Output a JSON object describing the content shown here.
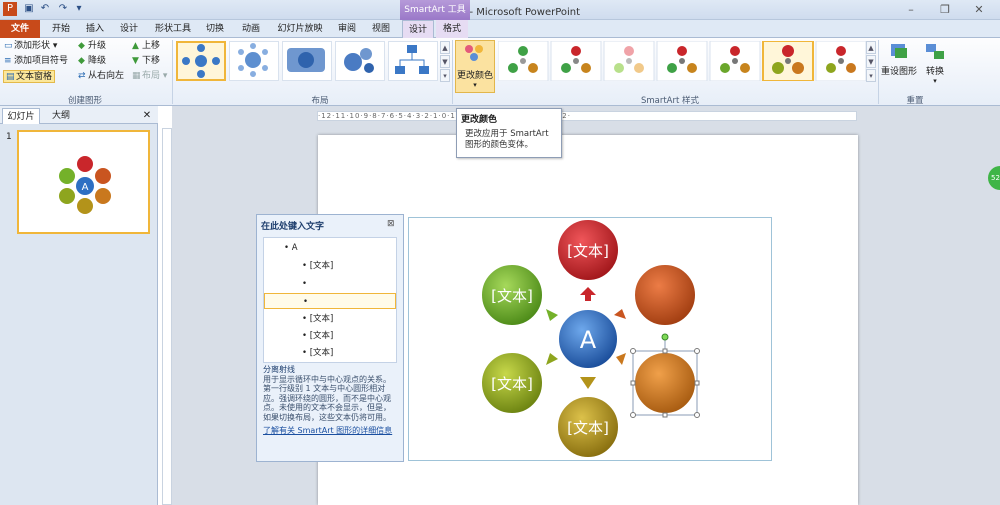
{
  "titlebar": {
    "title": "演示文稿1 - Microsoft PowerPoint",
    "context_group": "SmartArt 工具"
  },
  "tabs": [
    "文件",
    "开始",
    "插入",
    "设计",
    "形状工具",
    "切换",
    "动画",
    "幻灯片放映",
    "审阅",
    "视图",
    "设计",
    "格式"
  ],
  "ribbon": {
    "create_graphic": {
      "label": "创建图形",
      "add_shape": "添加形状",
      "add_bullet": "添加项目符号",
      "text_pane": "文本窗格",
      "promote": "升级",
      "demote": "降级",
      "right_to_left": "从右向左",
      "move_up": "上移",
      "move_down": "下移",
      "layout": "布局"
    },
    "layouts_label": "布局",
    "change_colors": "更改颜色",
    "styles_label": "SmartArt 样式",
    "reset_graphic": "重设图形",
    "convert": "转换",
    "reset_label": "重置"
  },
  "tooltip": {
    "title": "更改颜色",
    "body": "更改应用于 SmartArt 图形的颜色变体。"
  },
  "left_pane": {
    "tab_slides": "幻灯片",
    "tab_outline": "大纲",
    "slide_number": "1",
    "thumb_center": "A"
  },
  "ruler": {
    "marks": "·12·11·10·9·8·7·6·5·4·3·2·1·0·1·2·3·4·5·6·7·8·9·10·11·12·"
  },
  "text_pane": {
    "title": "在此处键入文字",
    "items": [
      "A",
      "[文本]",
      "",
      "",
      "[文本]",
      "[文本]",
      "[文本]"
    ],
    "desc_title": "分离射线",
    "desc_body": "用于显示循环中与中心观点的关系。第一行级别 1 文本与中心圆形相对应。强调环绕的圆形，而不是中心观点。未使用的文本不会显示，但是，如果切换布局，这些文本仍将可用。",
    "link": "了解有关 SmartArt 图形的详细信息"
  },
  "smartart": {
    "center": "A",
    "nodes": [
      "[文本]",
      "",
      "",
      "[文本]",
      "[文本]",
      "[文本]"
    ]
  },
  "colors": {
    "red": "#c9262b",
    "orange_red": "#c95520",
    "orange": "#c9781e",
    "gold": "#b3931a",
    "lime": "#8ea51e",
    "green": "#74b12a",
    "blue": "#2d6fc3"
  },
  "side_badge": "52"
}
